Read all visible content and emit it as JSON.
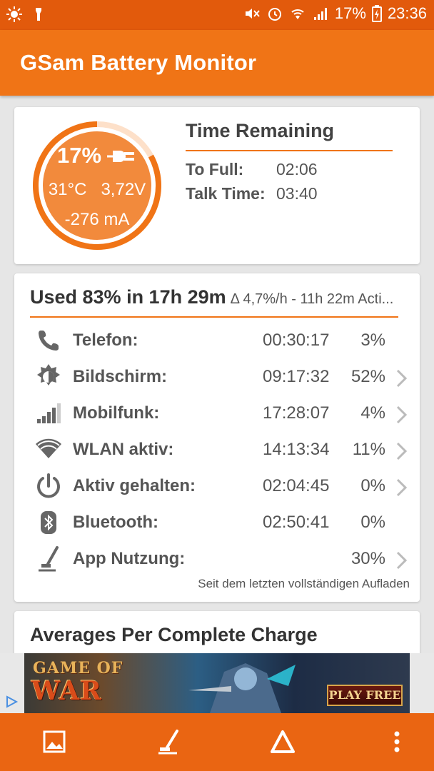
{
  "status_bar": {
    "battery_percent": "17%",
    "time": "23:36",
    "icons": [
      "brightness-icon",
      "flashlight-icon",
      "mute-icon",
      "alarm-icon",
      "wifi-icon",
      "signal-icon",
      "battery-charging-icon"
    ]
  },
  "app_bar": {
    "title": "GSam Battery Monitor"
  },
  "battery_gauge": {
    "percent": "17%",
    "level": 0.17,
    "temperature": "31°C",
    "voltage": "3,72V",
    "current": "-276 mA",
    "plug_icon": "charger-plug-icon"
  },
  "time_remaining": {
    "title": "Time Remaining",
    "to_full_label": "To Full:",
    "to_full_value": "02:06",
    "talk_label": "Talk Time:",
    "talk_value": "03:40"
  },
  "usage": {
    "headline": "Used 83% in 17h 29m",
    "subline": "Δ 4,7%/h - 11h 22m Acti...",
    "rows": [
      {
        "icon": "phone-icon",
        "label": "Telefon:",
        "time": "00:30:17",
        "percent": "3%",
        "chevron": false
      },
      {
        "icon": "screen-brightness-icon",
        "label": "Bildschirm:",
        "time": "09:17:32",
        "percent": "52%",
        "chevron": true
      },
      {
        "icon": "cell-signal-icon",
        "label": "Mobilfunk:",
        "time": "17:28:07",
        "percent": "4%",
        "chevron": true
      },
      {
        "icon": "wifi-icon",
        "label": "WLAN aktiv:",
        "time": "14:13:34",
        "percent": "11%",
        "chevron": true
      },
      {
        "icon": "power-icon",
        "label": "Aktiv gehalten:",
        "time": "02:04:45",
        "percent": "0%",
        "chevron": true
      },
      {
        "icon": "bluetooth-icon",
        "label": "Bluetooth:",
        "time": "02:50:41",
        "percent": "0%",
        "chevron": false
      },
      {
        "icon": "app-usage-icon",
        "label": "App Nutzung:",
        "time": "",
        "percent": "30%",
        "chevron": true
      }
    ],
    "footnote": "Seit dem letzten vollständigen Aufladen"
  },
  "averages": {
    "title": "Averages Per Complete Charge"
  },
  "ad": {
    "logo_line1": "GAME OF",
    "logo_line2": "WAR",
    "cta": "PLAY FREE"
  },
  "bottom_bar": {
    "buttons": [
      "image-icon",
      "app-usage-icon",
      "delta-icon",
      "overflow-menu-icon"
    ]
  },
  "colors": {
    "primary": "#f07416",
    "status_bar": "#e25a0c",
    "text": "#555555"
  }
}
